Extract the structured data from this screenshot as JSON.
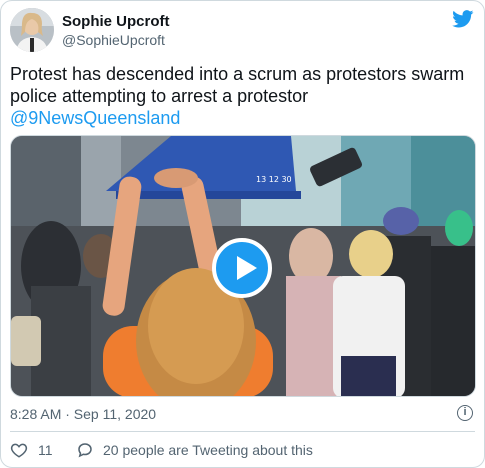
{
  "author": {
    "name": "Sophie Upcroft",
    "handle": "@SophieUpcroft"
  },
  "tweet": {
    "text": "Protest has descended into a scrum as protestors swarm police attempting to arrest a protestor",
    "mention": "@9NewsQueensland"
  },
  "media": {
    "type": "video",
    "tent_text": "13 12 30"
  },
  "meta": {
    "timestamp": "8:28 AM · Sep 11, 2020"
  },
  "actions": {
    "like_count": "11",
    "reply_text": "20 people are Tweeting about this"
  },
  "colors": {
    "brand": "#1d9bf0",
    "secondary_text": "#536471",
    "border": "#cfd9de"
  },
  "icons": {
    "brand": "twitter-bird-icon",
    "info": "info-icon",
    "like": "heart-icon",
    "reply": "speech-bubble-icon",
    "media": "play-icon"
  }
}
